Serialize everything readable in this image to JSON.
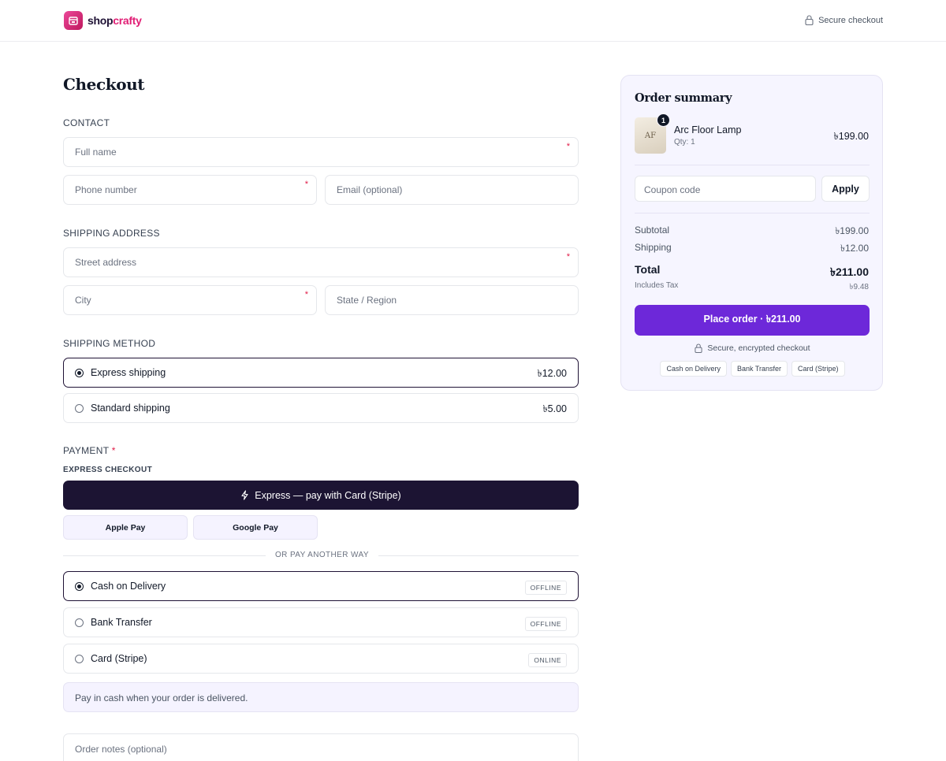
{
  "header": {
    "brand_a": "shop",
    "brand_b": "crafty",
    "secure_label": "Secure checkout",
    "icons": {
      "logo": "store-icon",
      "secure": "lock-icon"
    }
  },
  "checkout": {
    "title": "Checkout",
    "contact": {
      "label": "CONTACT",
      "full_name_placeholder": "Full name",
      "phone_placeholder": "Phone number",
      "email_placeholder": "Email (optional)",
      "required_mark": "*"
    },
    "shipping_address": {
      "label": "SHIPPING ADDRESS",
      "street_placeholder": "Street address",
      "city_placeholder": "City",
      "state_placeholder": "State / Region"
    },
    "shipping_method": {
      "label": "SHIPPING METHOD",
      "options": [
        {
          "label": "Express shipping",
          "price": "৳12.00",
          "selected": true
        },
        {
          "label": "Standard shipping",
          "price": "৳5.00",
          "selected": false
        }
      ]
    },
    "payment": {
      "label": "PAYMENT",
      "required_mark": "*",
      "express_label": "EXPRESS CHECKOUT",
      "express_button": "Express — pay with Card (Stripe)",
      "apple_pay": "Apple Pay",
      "google_pay": "Google Pay",
      "divider_text": "OR PAY ANOTHER WAY",
      "methods": [
        {
          "label": "Cash on Delivery",
          "tag": "OFFLINE",
          "selected": true
        },
        {
          "label": "Bank Transfer",
          "tag": "OFFLINE",
          "selected": false
        },
        {
          "label": "Card (Stripe)",
          "tag": "ONLINE",
          "selected": false
        }
      ],
      "method_note": "Pay in cash when your order is delivered."
    },
    "order_notes_placeholder": "Order notes (optional)"
  },
  "summary": {
    "title": "Order summary",
    "item": {
      "thumb_text": "AF",
      "qty_badge": "1",
      "name": "Arc Floor Lamp",
      "qty": "Qty: 1",
      "price": "৳199.00"
    },
    "coupon_placeholder": "Coupon code",
    "apply_label": "Apply",
    "subtotal_label": "Subtotal",
    "subtotal_value": "৳199.00",
    "shipping_label": "Shipping",
    "shipping_value": "৳12.00",
    "total_label": "Total",
    "total_value": "৳211.00",
    "tax_label": "Includes Tax",
    "tax_value": "৳9.48",
    "place_order": "Place order · ৳211.00",
    "secure_note": "Secure, encrypted checkout",
    "payment_pills": [
      "Cash on Delivery",
      "Bank Transfer",
      "Card (Stripe)"
    ]
  },
  "colors": {
    "primary": "#6d28d9",
    "dark": "#1c1433",
    "brand_pink": "#e11d74",
    "summary_bg": "#f6f5ff"
  }
}
